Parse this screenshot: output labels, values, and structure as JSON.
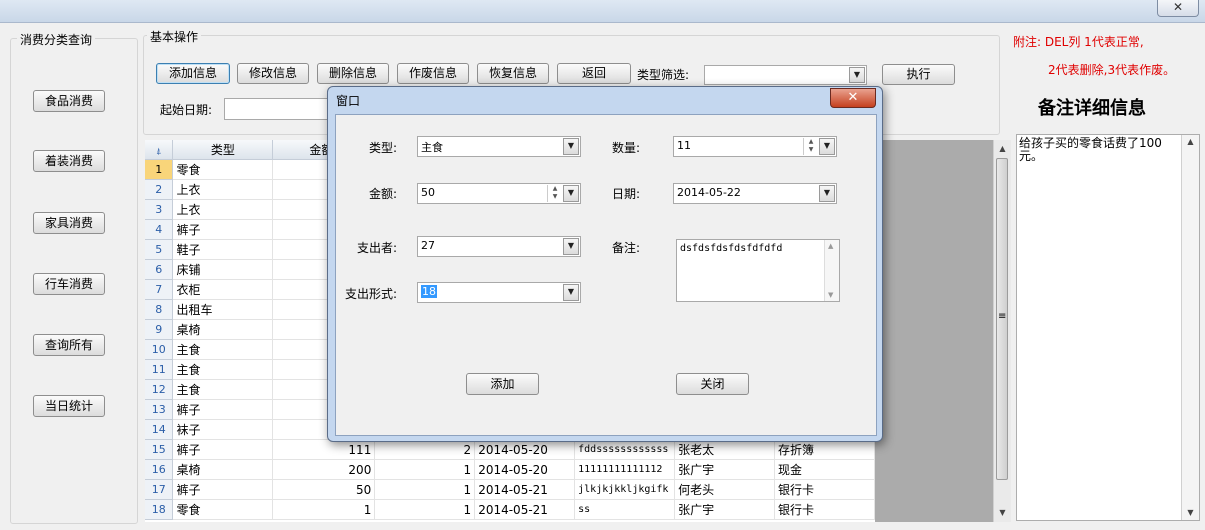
{
  "window": {
    "close_glyph": "✕"
  },
  "sidebar": {
    "title": "消费分类查询",
    "buttons": [
      "食品消费",
      "着装消费",
      "家具消费",
      "行车消费",
      "查询所有",
      "当日统计"
    ]
  },
  "basic_ops": {
    "title": "基本操作",
    "buttons": [
      "添加信息",
      "修改信息",
      "删除信息",
      "作废信息",
      "恢复信息",
      "返回"
    ],
    "filter_label": "类型筛选:",
    "filter_value": "",
    "execute_label": "执行",
    "start_date_label": "起始日期:"
  },
  "notes": {
    "line1": "附注: DEL列  1代表正常,",
    "line2": "2代表删除,3代表作废。",
    "detail_title": "备注详细信息",
    "detail_text": "给孩子买的零食话费了100元。"
  },
  "grid": {
    "headers": {
      "corner": "",
      "type": "类型",
      "amount": "金额"
    },
    "rows": [
      {
        "n": "1",
        "type": "零食",
        "amount": "",
        "qty": "",
        "date": "",
        "remark": "",
        "payer": "",
        "method": ""
      },
      {
        "n": "2",
        "type": "上衣",
        "amount": "",
        "qty": "",
        "date": "",
        "remark": "",
        "payer": "",
        "method": ""
      },
      {
        "n": "3",
        "type": "上衣",
        "amount": "",
        "qty": "",
        "date": "",
        "remark": "",
        "payer": "",
        "method": ""
      },
      {
        "n": "4",
        "type": "裤子",
        "amount": "",
        "qty": "",
        "date": "",
        "remark": "",
        "payer": "",
        "method": ""
      },
      {
        "n": "5",
        "type": "鞋子",
        "amount": "",
        "qty": "",
        "date": "",
        "remark": "",
        "payer": "",
        "method": ""
      },
      {
        "n": "6",
        "type": "床铺",
        "amount": "",
        "qty": "",
        "date": "",
        "remark": "",
        "payer": "",
        "method": ""
      },
      {
        "n": "7",
        "type": "衣柜",
        "amount": "",
        "qty": "",
        "date": "",
        "remark": "",
        "payer": "",
        "method": ""
      },
      {
        "n": "8",
        "type": "出租车",
        "amount": "",
        "qty": "",
        "date": "",
        "remark": "",
        "payer": "",
        "method": ""
      },
      {
        "n": "9",
        "type": "桌椅",
        "amount": "",
        "qty": "",
        "date": "",
        "remark": "",
        "payer": "",
        "method": ""
      },
      {
        "n": "10",
        "type": "主食",
        "amount": "",
        "qty": "",
        "date": "",
        "remark": "",
        "payer": "",
        "method": ""
      },
      {
        "n": "11",
        "type": "主食",
        "amount": "",
        "qty": "",
        "date": "",
        "remark": "",
        "payer": "",
        "method": ""
      },
      {
        "n": "12",
        "type": "主食",
        "amount": "",
        "qty": "",
        "date": "",
        "remark": "",
        "payer": "",
        "method": ""
      },
      {
        "n": "13",
        "type": "裤子",
        "amount": "",
        "qty": "",
        "date": "",
        "remark": "",
        "payer": "",
        "method": ""
      },
      {
        "n": "14",
        "type": "袜子",
        "amount": "",
        "qty": "",
        "date": "",
        "remark": "",
        "payer": "",
        "method": ""
      },
      {
        "n": "15",
        "type": "裤子",
        "amount": "111",
        "qty": "2",
        "date": "2014-05-20",
        "remark": "fddssssssssssss",
        "payer": "张老太",
        "method": "存折簿"
      },
      {
        "n": "16",
        "type": "桌椅",
        "amount": "200",
        "qty": "1",
        "date": "2014-05-20",
        "remark": "11111111111112",
        "payer": "张广宇",
        "method": "现金"
      },
      {
        "n": "17",
        "type": "裤子",
        "amount": "50",
        "qty": "1",
        "date": "2014-05-21",
        "remark": "jlkjkjkkljkgifk",
        "payer": "何老头",
        "method": "银行卡"
      },
      {
        "n": "18",
        "type": "零食",
        "amount": "1",
        "qty": "1",
        "date": "2014-05-21",
        "remark": "ss",
        "payer": "张广宇",
        "method": "银行卡"
      }
    ]
  },
  "dialog": {
    "title": "窗口",
    "close_glyph": "✕",
    "type_label": "类型:",
    "type_value": "主食",
    "qty_label": "数量:",
    "qty_value": "11",
    "amount_label": "金额:",
    "amount_value": "50",
    "date_label": "日期:",
    "date_value": "2014-05-22",
    "payer_label": "支出者:",
    "payer_value": "27",
    "remark_label": "备注:",
    "remark_value": "dsfdsfdsfdsfdfdfd",
    "method_label": "支出形式:",
    "method_value": "18",
    "add_label": "添加",
    "close_label": "关闭"
  },
  "icons": {
    "dropdown": "▼",
    "up": "▲",
    "down": "▼",
    "grip": "≡"
  }
}
